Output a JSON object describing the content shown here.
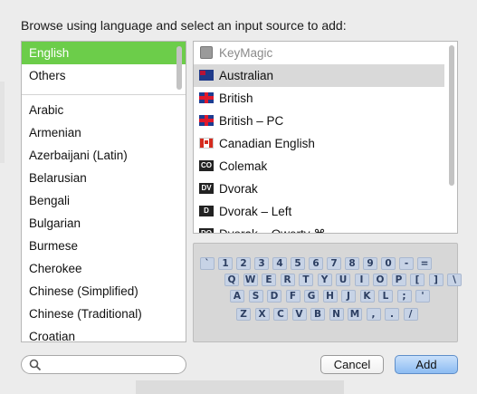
{
  "header": "Browse using language and select an input source to add:",
  "languages": [
    "English",
    "Others",
    "Arabic",
    "Armenian",
    "Azerbaijani (Latin)",
    "Belarusian",
    "Bengali",
    "Bulgarian",
    "Burmese",
    "Cherokee",
    "Chinese (Simplified)",
    "Chinese (Traditional)",
    "Croatian"
  ],
  "selected_language": "English",
  "sources": [
    {
      "label": "KeyMagic",
      "icon": "keymagic-icon",
      "icon_text": "",
      "state": "dim"
    },
    {
      "label": "Australian",
      "icon": "australia-flag-icon",
      "icon_text": "",
      "state": "selected"
    },
    {
      "label": "British",
      "icon": "uk-flag-icon",
      "icon_text": "",
      "state": ""
    },
    {
      "label": "British – PC",
      "icon": "uk-pc-flag-icon",
      "icon_text": "",
      "state": ""
    },
    {
      "label": "Canadian English",
      "icon": "canada-flag-icon",
      "icon_text": "",
      "state": ""
    },
    {
      "label": "Colemak",
      "icon": "colemak-icon",
      "icon_text": "CO",
      "state": ""
    },
    {
      "label": "Dvorak",
      "icon": "dvorak-icon",
      "icon_text": "DV",
      "state": ""
    },
    {
      "label": "Dvorak – Left",
      "icon": "dvorak-left-icon",
      "icon_text": "D",
      "state": ""
    },
    {
      "label": "Dvorak – Qwerty ⌘",
      "icon": "dvorak-qwerty-icon",
      "icon_text": "DQ",
      "state": ""
    }
  ],
  "keyboard_rows": [
    [
      "`",
      "1",
      "2",
      "3",
      "4",
      "5",
      "6",
      "7",
      "8",
      "9",
      "0",
      "-",
      "="
    ],
    [
      "Q",
      "W",
      "E",
      "R",
      "T",
      "Y",
      "U",
      "I",
      "O",
      "P",
      "[",
      "]",
      "\\"
    ],
    [
      "A",
      "S",
      "D",
      "F",
      "G",
      "H",
      "J",
      "K",
      "L",
      ";",
      "'"
    ],
    [
      "Z",
      "X",
      "C",
      "V",
      "B",
      "N",
      "M",
      ",",
      ".",
      "/"
    ]
  ],
  "search": {
    "placeholder": "",
    "value": ""
  },
  "buttons": {
    "cancel": "Cancel",
    "add": "Add"
  },
  "colors": {
    "selected_language_bg": "#6ccd4a",
    "selected_source_bg": "#d9d9d9",
    "key_bg": "#c7d3e6",
    "add_button": "#8cbcf2"
  }
}
